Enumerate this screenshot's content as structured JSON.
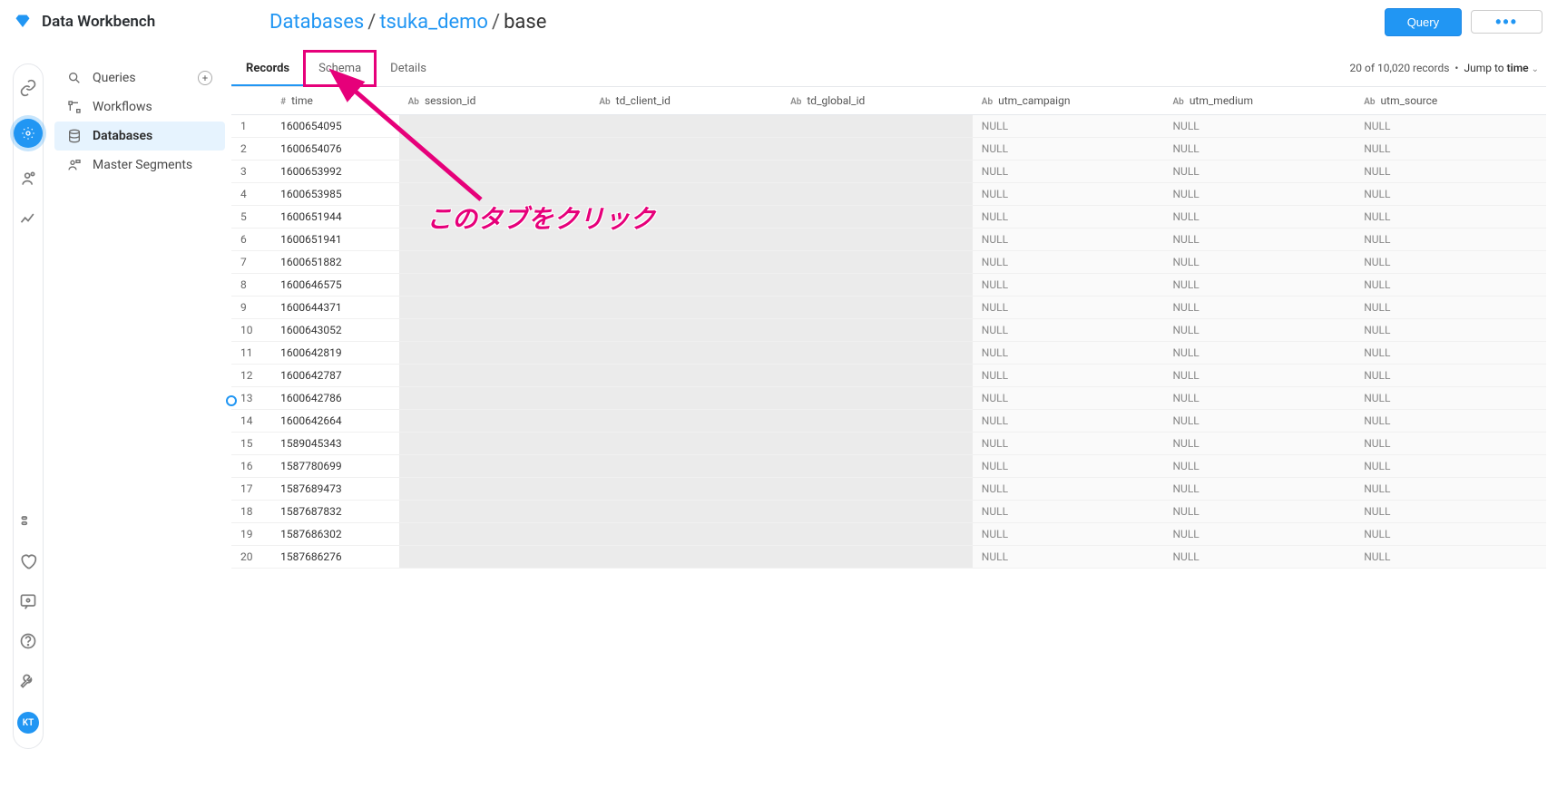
{
  "app": {
    "title": "Data Workbench"
  },
  "breadcrumb": {
    "root": "Databases",
    "db": "tsuka_demo",
    "table": "base"
  },
  "actions": {
    "query": "Query"
  },
  "iconRail": {
    "avatarInitials": "KT"
  },
  "sidenav": {
    "items": [
      {
        "label": "Queries",
        "hasPlus": true
      },
      {
        "label": "Workflows",
        "hasPlus": false
      },
      {
        "label": "Databases",
        "hasPlus": false,
        "active": true
      },
      {
        "label": "Master Segments",
        "hasPlus": false
      }
    ]
  },
  "tabs": [
    {
      "label": "Records",
      "active": true
    },
    {
      "label": "Schema",
      "highlighted": true
    },
    {
      "label": "Details"
    }
  ],
  "recordsInfo": {
    "text": "20 of 10,020 records",
    "jumpLabel": "Jump to",
    "jumpField": "time"
  },
  "columns": [
    {
      "type": "#",
      "name": "time"
    },
    {
      "type": "Ab",
      "name": "session_id"
    },
    {
      "type": "Ab",
      "name": "td_client_id"
    },
    {
      "type": "Ab",
      "name": "td_global_id"
    },
    {
      "type": "Ab",
      "name": "utm_campaign"
    },
    {
      "type": "Ab",
      "name": "utm_medium"
    },
    {
      "type": "Ab",
      "name": "utm_source"
    }
  ],
  "rows": [
    {
      "n": 1,
      "time": "1600654095",
      "campaign": "NULL",
      "medium": "NULL",
      "source": "NULL"
    },
    {
      "n": 2,
      "time": "1600654076",
      "campaign": "NULL",
      "medium": "NULL",
      "source": "NULL"
    },
    {
      "n": 3,
      "time": "1600653992",
      "campaign": "NULL",
      "medium": "NULL",
      "source": "NULL"
    },
    {
      "n": 4,
      "time": "1600653985",
      "campaign": "NULL",
      "medium": "NULL",
      "source": "NULL"
    },
    {
      "n": 5,
      "time": "1600651944",
      "campaign": "NULL",
      "medium": "NULL",
      "source": "NULL"
    },
    {
      "n": 6,
      "time": "1600651941",
      "campaign": "NULL",
      "medium": "NULL",
      "source": "NULL"
    },
    {
      "n": 7,
      "time": "1600651882",
      "campaign": "NULL",
      "medium": "NULL",
      "source": "NULL"
    },
    {
      "n": 8,
      "time": "1600646575",
      "campaign": "NULL",
      "medium": "NULL",
      "source": "NULL"
    },
    {
      "n": 9,
      "time": "1600644371",
      "campaign": "NULL",
      "medium": "NULL",
      "source": "NULL"
    },
    {
      "n": 10,
      "time": "1600643052",
      "campaign": "NULL",
      "medium": "NULL",
      "source": "NULL"
    },
    {
      "n": 11,
      "time": "1600642819",
      "campaign": "NULL",
      "medium": "NULL",
      "source": "NULL"
    },
    {
      "n": 12,
      "time": "1600642787",
      "campaign": "NULL",
      "medium": "NULL",
      "source": "NULL"
    },
    {
      "n": 13,
      "time": "1600642786",
      "campaign": "NULL",
      "medium": "NULL",
      "source": "NULL"
    },
    {
      "n": 14,
      "time": "1600642664",
      "campaign": "NULL",
      "medium": "NULL",
      "source": "NULL"
    },
    {
      "n": 15,
      "time": "1589045343",
      "campaign": "NULL",
      "medium": "NULL",
      "source": "NULL"
    },
    {
      "n": 16,
      "time": "1587780699",
      "campaign": "NULL",
      "medium": "NULL",
      "source": "NULL"
    },
    {
      "n": 17,
      "time": "1587689473",
      "campaign": "NULL",
      "medium": "NULL",
      "source": "NULL"
    },
    {
      "n": 18,
      "time": "1587687832",
      "campaign": "NULL",
      "medium": "NULL",
      "source": "NULL"
    },
    {
      "n": 19,
      "time": "1587686302",
      "campaign": "NULL",
      "medium": "NULL",
      "source": "NULL"
    },
    {
      "n": 20,
      "time": "1587686276",
      "campaign": "NULL",
      "medium": "NULL",
      "source": "NULL"
    }
  ],
  "annotation": {
    "text": "このタブをクリック"
  }
}
